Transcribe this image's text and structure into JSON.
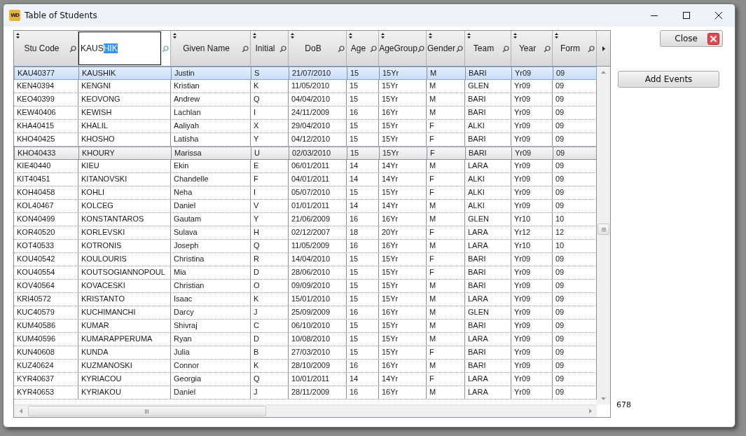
{
  "window": {
    "title": "Table of Students",
    "app_icon_text": "WD"
  },
  "table": {
    "columns": [
      {
        "kind": "label",
        "label": "Stu Code"
      },
      {
        "kind": "search",
        "typed": "KAUS",
        "highlighted": "HIK"
      },
      {
        "kind": "label",
        "label": "Given Name"
      },
      {
        "kind": "label",
        "label": "Initial"
      },
      {
        "kind": "label",
        "label": "DoB"
      },
      {
        "kind": "label",
        "label": "Age"
      },
      {
        "kind": "label",
        "label": "AgeGroup"
      },
      {
        "kind": "label",
        "label": "Gender"
      },
      {
        "kind": "label",
        "label": "Team"
      },
      {
        "kind": "label",
        "label": "Year"
      },
      {
        "kind": "label",
        "label": "Form"
      }
    ],
    "rows": [
      {
        "selected": true,
        "current": false,
        "cells": [
          "KAU40377",
          "KAUSHIK",
          "Justin",
          "S",
          "21/07/2010",
          "15",
          "15Yr",
          "M",
          "BARI",
          "Yr09",
          "09"
        ]
      },
      {
        "selected": false,
        "current": false,
        "cells": [
          "KEN40394",
          "KENGNI",
          "Kristian",
          "K",
          "11/05/2010",
          "15",
          "15Yr",
          "M",
          "GLEN",
          "Yr09",
          "09"
        ]
      },
      {
        "selected": false,
        "current": false,
        "cells": [
          "KEO40399",
          "KEOVONG",
          "Andrew",
          "Q",
          "04/04/2010",
          "15",
          "15Yr",
          "M",
          "BARI",
          "Yr09",
          "09"
        ]
      },
      {
        "selected": false,
        "current": false,
        "cells": [
          "KEW40406",
          "KEWISH",
          "Lachlan",
          "I",
          "24/11/2009",
          "16",
          "16Yr",
          "M",
          "BARI",
          "Yr09",
          "09"
        ]
      },
      {
        "selected": false,
        "current": false,
        "cells": [
          "KHA40415",
          "KHALIL",
          "Aaliyah",
          "X",
          "29/04/2010",
          "15",
          "15Yr",
          "F",
          "ALKI",
          "Yr09",
          "09"
        ]
      },
      {
        "selected": false,
        "current": false,
        "cells": [
          "KHO40425",
          "KHOSHO",
          "Latisha",
          "Y",
          "04/12/2010",
          "15",
          "15Yr",
          "F",
          "BARI",
          "Yr09",
          "09"
        ]
      },
      {
        "selected": false,
        "current": true,
        "cells": [
          "KHO40433",
          "KHOURY",
          "Marissa",
          "U",
          "02/03/2010",
          "15",
          "15Yr",
          "F",
          "BARI",
          "Yr09",
          "09"
        ]
      },
      {
        "selected": false,
        "current": false,
        "cells": [
          "KIE40440",
          "KIEU",
          "Ekin",
          "E",
          "06/01/2011",
          "14",
          "14Yr",
          "M",
          "LARA",
          "Yr09",
          "09"
        ]
      },
      {
        "selected": false,
        "current": false,
        "cells": [
          "KIT40451",
          "KITANOVSKI",
          "Chandelle",
          "F",
          "04/01/2011",
          "14",
          "14Yr",
          "F",
          "ALKI",
          "Yr09",
          "09"
        ]
      },
      {
        "selected": false,
        "current": false,
        "cells": [
          "KOH40458",
          "KOHLI",
          "Neha",
          "I",
          "05/07/2010",
          "15",
          "15Yr",
          "F",
          "ALKI",
          "Yr09",
          "09"
        ]
      },
      {
        "selected": false,
        "current": false,
        "cells": [
          "KOL40467",
          "KOLCEG",
          "Daniel",
          "V",
          "01/01/2011",
          "14",
          "14Yr",
          "M",
          "ALKI",
          "Yr09",
          "09"
        ]
      },
      {
        "selected": false,
        "current": false,
        "cells": [
          "KON40499",
          "KONSTANTAROS",
          "Gautam",
          "Y",
          "21/06/2009",
          "16",
          "16Yr",
          "M",
          "GLEN",
          "Yr10",
          "10"
        ]
      },
      {
        "selected": false,
        "current": false,
        "cells": [
          "KOR40520",
          "KORLEVSKI",
          "Sulava",
          "H",
          "02/12/2007",
          "18",
          "20Yr",
          "F",
          "LARA",
          "Yr12",
          "12"
        ]
      },
      {
        "selected": false,
        "current": false,
        "cells": [
          "KOT40533",
          "KOTRONIS",
          "Joseph",
          "Q",
          "11/05/2009",
          "16",
          "16Yr",
          "M",
          "LARA",
          "Yr10",
          "10"
        ]
      },
      {
        "selected": false,
        "current": false,
        "cells": [
          "KOU40542",
          "KOULOURIS",
          "Christina",
          "R",
          "14/04/2010",
          "15",
          "15Yr",
          "F",
          "BARI",
          "Yr09",
          "09"
        ]
      },
      {
        "selected": false,
        "current": false,
        "cells": [
          "KOU40554",
          "KOUTSOGIANNOPOUL",
          "Mia",
          "D",
          "28/06/2010",
          "15",
          "15Yr",
          "F",
          "BARI",
          "Yr09",
          "09"
        ]
      },
      {
        "selected": false,
        "current": false,
        "cells": [
          "KOV40564",
          "KOVACESKI",
          "Christian",
          "O",
          "09/09/2010",
          "15",
          "15Yr",
          "M",
          "BARI",
          "Yr09",
          "09"
        ]
      },
      {
        "selected": false,
        "current": false,
        "cells": [
          "KRI40572",
          "KRISTANTO",
          "Isaac",
          "K",
          "15/01/2010",
          "15",
          "15Yr",
          "M",
          "LARA",
          "Yr09",
          "09"
        ]
      },
      {
        "selected": false,
        "current": false,
        "cells": [
          "KUC40579",
          "KUCHIMANCHI",
          "Darcy",
          "J",
          "25/09/2009",
          "16",
          "16Yr",
          "M",
          "GLEN",
          "Yr09",
          "09"
        ]
      },
      {
        "selected": false,
        "current": false,
        "cells": [
          "KUM40586",
          "KUMAR",
          "Shivraj",
          "C",
          "06/10/2010",
          "15",
          "15Yr",
          "M",
          "BARI",
          "Yr09",
          "09"
        ]
      },
      {
        "selected": false,
        "current": false,
        "cells": [
          "KUM40596",
          "KUMARAPPERUMA",
          "Ryan",
          "D",
          "10/08/2010",
          "15",
          "15Yr",
          "M",
          "LARA",
          "Yr09",
          "09"
        ]
      },
      {
        "selected": false,
        "current": false,
        "cells": [
          "KUN40608",
          "KUNDA",
          "Julia",
          "B",
          "27/03/2010",
          "15",
          "15Yr",
          "F",
          "BARI",
          "Yr09",
          "09"
        ]
      },
      {
        "selected": false,
        "current": false,
        "cells": [
          "KUZ40624",
          "KUZMANOSKI",
          "Connor",
          "K",
          "28/10/2009",
          "16",
          "16Yr",
          "M",
          "BARI",
          "Yr09",
          "09"
        ]
      },
      {
        "selected": false,
        "current": false,
        "cells": [
          "KYR40637",
          "KYRIACOU",
          "Georgia",
          "Q",
          "10/01/2011",
          "14",
          "14Yr",
          "F",
          "LARA",
          "Yr09",
          "09"
        ]
      },
      {
        "selected": false,
        "current": false,
        "cells": [
          "KYR40653",
          "KYRIAKOU",
          "Daniel",
          "J",
          "28/11/2009",
          "16",
          "16Yr",
          "M",
          "LARA",
          "Yr09",
          "09"
        ]
      }
    ]
  },
  "buttons": {
    "close": "Close",
    "add_events": "Add Events"
  },
  "record_count": "678"
}
